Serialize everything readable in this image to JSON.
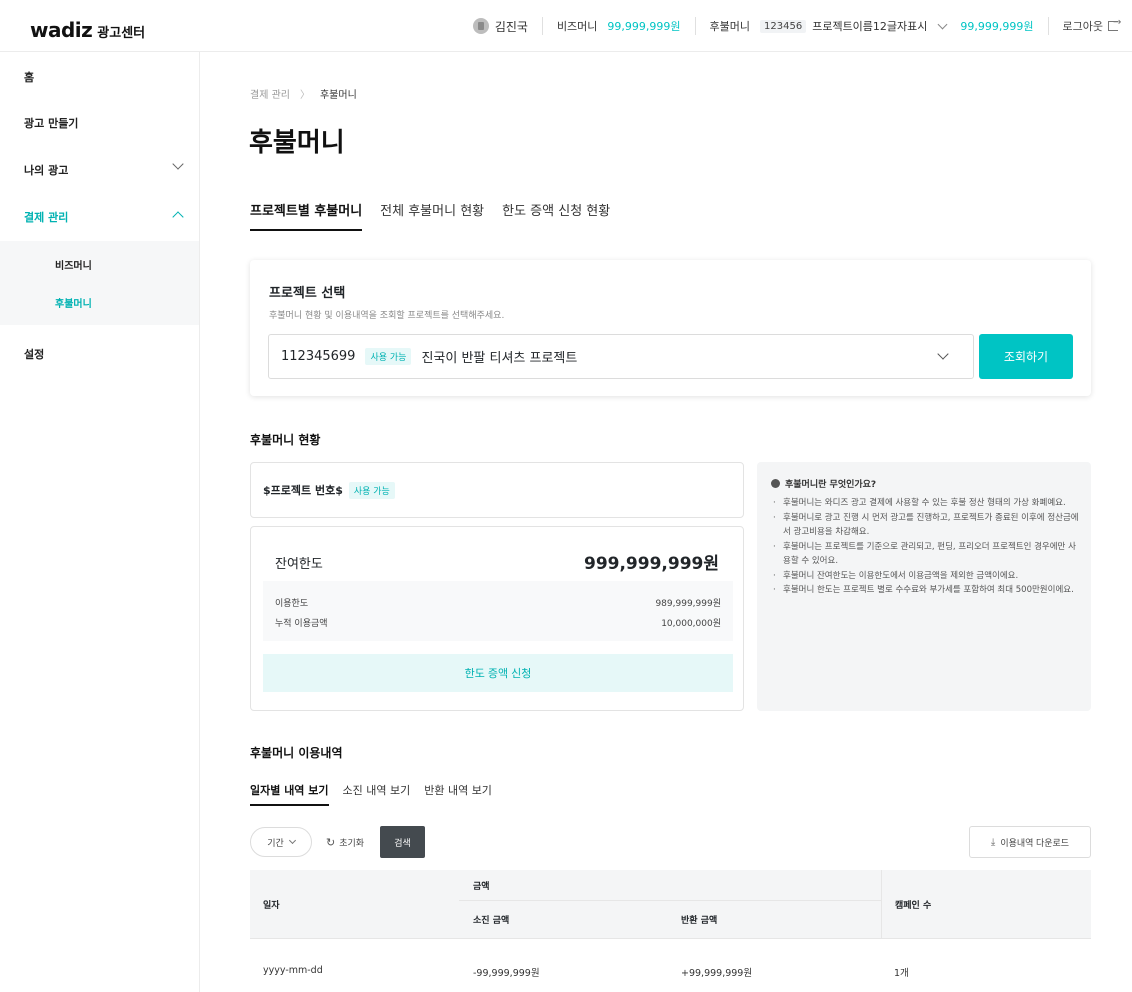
{
  "header": {
    "brand": "wadiz",
    "brand_sub": "광고센터",
    "user_name": "김진국",
    "biz_money_label": "비즈머니",
    "biz_money_value": "99,999,999원",
    "postpaid_label": "후불머니",
    "project_id": "123456",
    "project_name": "프로젝트이름12글자표시",
    "postpaid_value": "99,999,999원",
    "logout_label": "로그아웃"
  },
  "sidebar": {
    "items": [
      {
        "label": "홈"
      },
      {
        "label": "광고 만들기"
      },
      {
        "label": "나의 광고"
      },
      {
        "label": "결제 관리"
      },
      {
        "label": "설정"
      }
    ],
    "sub_items": [
      {
        "label": "비즈머니"
      },
      {
        "label": "후불머니"
      }
    ]
  },
  "breadcrumb": {
    "parent": "결제 관리",
    "separator": "〉",
    "current": "후불머니"
  },
  "page_title": "후불머니",
  "tabs": [
    {
      "label": "프로젝트별 후불머니",
      "active": true
    },
    {
      "label": "전체 후불머니 현황",
      "active": false
    },
    {
      "label": "한도 증액 신청 현황",
      "active": false
    }
  ],
  "project_select": {
    "title": "프로젝트 선택",
    "description": "후불머니 현황 및 이용내역을 조회할 프로젝트를 선택해주세요.",
    "project_number": "112345699",
    "status_badge": "사용 가능",
    "project_name": "진국이 반팔 티셔츠 프로젝트",
    "query_button": "조회하기"
  },
  "status_section": {
    "title": "후불머니 현황",
    "project_label": "$프로젝트 번호$",
    "status_badge": "사용 가능",
    "remaining_label": "잔여한도",
    "remaining_value": "999,999,999원",
    "usage_limit_label": "이용한도",
    "usage_limit_value": "989,999,999원",
    "cumulative_label": "누적 이용금액",
    "cumulative_value": "10,000,000원",
    "increase_button": "한도 증액 신청"
  },
  "info": {
    "title": "후불머니란 무엇인가요?",
    "items": [
      "후불머니는 와디즈 광고 결제에 사용할 수 있는 후불 정산 형태의 가상 화폐예요.",
      "후불머니로 광고 진행 시 먼저 광고를 진행하고, 프로젝트가 종료된 이후에 정산금에서 광고비용을 차감해요.",
      "후불머니는 프로젝트를 기준으로 관리되고, 펀딩, 프리오더 프로젝트인 경우에만 사용할 수 있어요.",
      "후불머니 잔여한도는 이용한도에서 이용금액을 제외한 금액이에요.",
      "후불머니 한도는 프로젝트 별로 수수료와 부가세를 포함하여 최대 500만원이에요."
    ]
  },
  "history": {
    "title": "후불머니 이용내역",
    "sub_tabs": [
      {
        "label": "일자별 내역 보기",
        "active": true
      },
      {
        "label": "소진 내역 보기",
        "active": false
      },
      {
        "label": "반환 내역 보기",
        "active": false
      }
    ],
    "period_label": "기간",
    "reset_label": "초기화",
    "search_button": "검색",
    "download_button": "이용내역 다운로드",
    "columns": {
      "date": "일자",
      "amount": "금액",
      "consumed": "소진 금액",
      "refunded": "반환 금액",
      "campaigns": "캠페인 수"
    },
    "rows": [
      {
        "date": "yyyy-mm-dd",
        "consumed": "-99,999,999원",
        "refunded": "+99,999,999원",
        "campaigns": "1개"
      }
    ]
  },
  "colors": {
    "accent": "#00c4c4",
    "accent_text": "#00b2b2",
    "accent_bg": "#e6f8f8",
    "dark_button": "#444a4f"
  }
}
